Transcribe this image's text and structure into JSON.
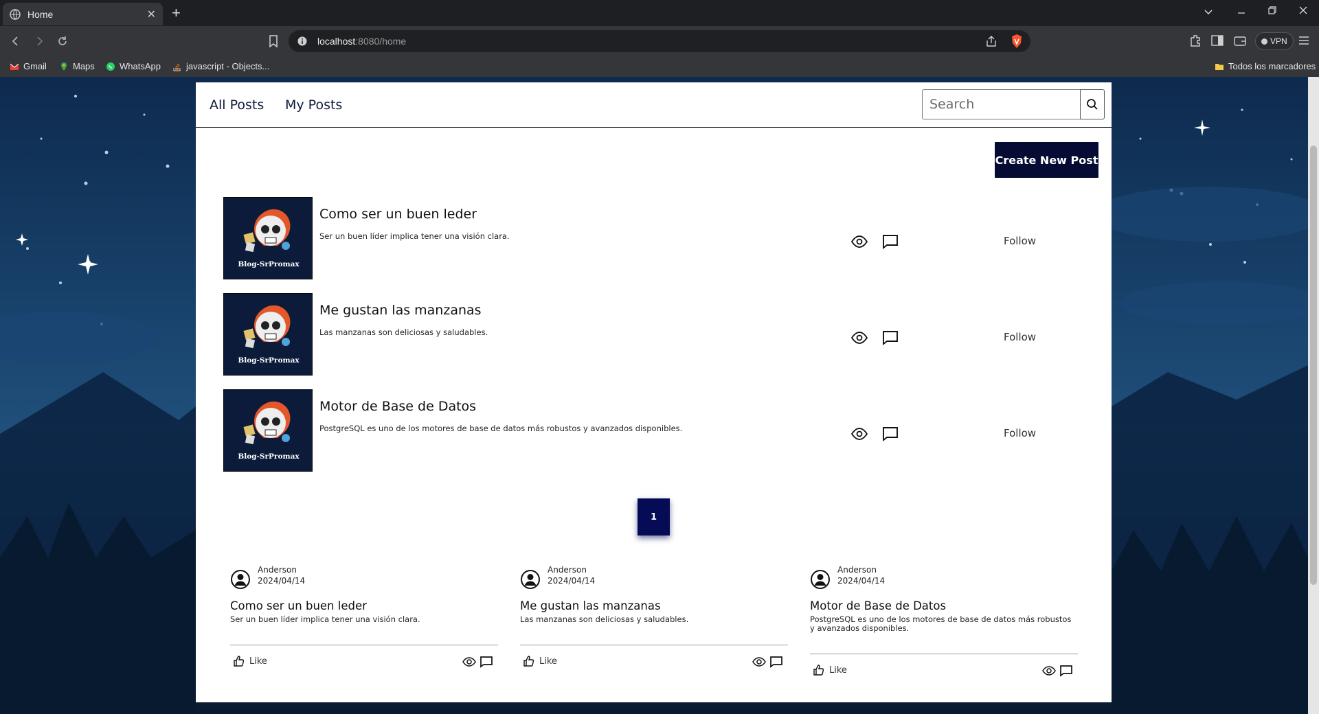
{
  "browser": {
    "tab_title": "Home",
    "tab_close": "✕",
    "new_tab": "+",
    "url_host": "localhost",
    "url_rest": ":8080/home",
    "vpn_label": "VPN",
    "bookmarks": [
      "Gmail",
      "Maps",
      "WhatsApp",
      "javascript - Objects..."
    ],
    "all_bookmarks": "Todos los marcadores"
  },
  "nav": {
    "all_posts": "All Posts",
    "my_posts": "My Posts",
    "search_placeholder": "Search"
  },
  "actions": {
    "create_new_post": "Create New Post"
  },
  "thumbnail_caption": "Blog-SrPromax",
  "posts": [
    {
      "title": "Como ser un buen leder",
      "description": "Ser un buen líder implica tener una visión clara.",
      "follow": "Follow"
    },
    {
      "title": "Me gustan las manzanas",
      "description": "Las manzanas son deliciosas y saludables.",
      "follow": "Follow"
    },
    {
      "title": "Motor de Base de Datos",
      "description": "PostgreSQL es uno de los motores de base de datos más robustos y avanzados disponibles.",
      "follow": "Follow"
    }
  ],
  "pagination": {
    "current_page": "1"
  },
  "cards": [
    {
      "author": "Anderson",
      "date": "2024/04/14",
      "title": "Como ser un buen leder",
      "description": "Ser un buen líder implica tener una visión clara.",
      "like": "Like"
    },
    {
      "author": "Anderson",
      "date": "2024/04/14",
      "title": "Me gustan las manzanas",
      "description": "Las manzanas son deliciosas y saludables.",
      "like": "Like"
    },
    {
      "author": "Anderson",
      "date": "2024/04/14",
      "title": "Motor de Base de Datos",
      "description": "PostgreSQL es uno de los motores de base de datos más robustos y avanzados disponibles.",
      "like": "Like"
    }
  ],
  "colors": {
    "brand_navy": "#060b33",
    "pager_blue": "#060b55",
    "browser_dark": "#35363a",
    "brave_orange": "#fb542b"
  }
}
